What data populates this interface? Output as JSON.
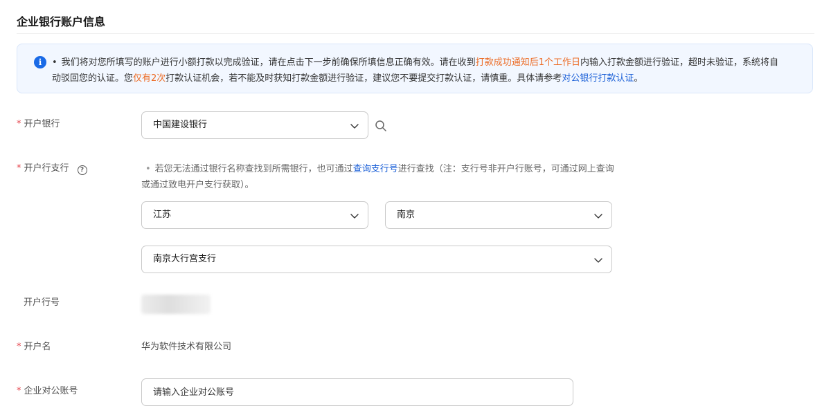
{
  "section": {
    "title": "企业银行账户信息"
  },
  "notice": {
    "bullet": "•",
    "part1": "我们将对您所填写的账户进行小额打款以完成验证，请在点击下一步前确保所填信息正确有效。请在收到",
    "highlight1": "打款成功通知后1个工作日",
    "part2": "内输入打款金额进行验证，超时未验证，系统将自动驳回您的认证。您",
    "highlight2": "仅有2次",
    "part3": "打款认证机会，若不能及时获知打款金额进行验证，建议您不要提交打款认证，请慎重。具体请参考",
    "link": "对公银行打款认证",
    "part4": "。",
    "icon": "info-icon"
  },
  "form": {
    "required_mark": "*",
    "bank": {
      "label": "开户银行",
      "value": "中国建设银行"
    },
    "branch": {
      "label": "开户行支行",
      "help_glyph": "?",
      "hint_bullet": "•",
      "hint_part1": "若您无法通过银行名称查找到所需银行，也可通过",
      "hint_link": "查询支行号",
      "hint_part2": "进行查找（注：支行号非开户行账号，可通过网上查询或通过致电开户支行获取）。",
      "province": "江苏",
      "city": "南京",
      "branch_name": "南京大行宫支行"
    },
    "bank_number": {
      "label": "开户行号"
    },
    "account_name": {
      "label": "开户名",
      "value": "华为软件技术有限公司"
    },
    "account_number": {
      "label": "企业对公账号",
      "placeholder": "请输入企业对公账号",
      "value": ""
    }
  },
  "colors": {
    "accent": "#1a6ae6",
    "link": "#1a5fd7",
    "highlight": "#ec6b24",
    "required": "#e5434b",
    "notice_bg": "#f2f7ff"
  }
}
